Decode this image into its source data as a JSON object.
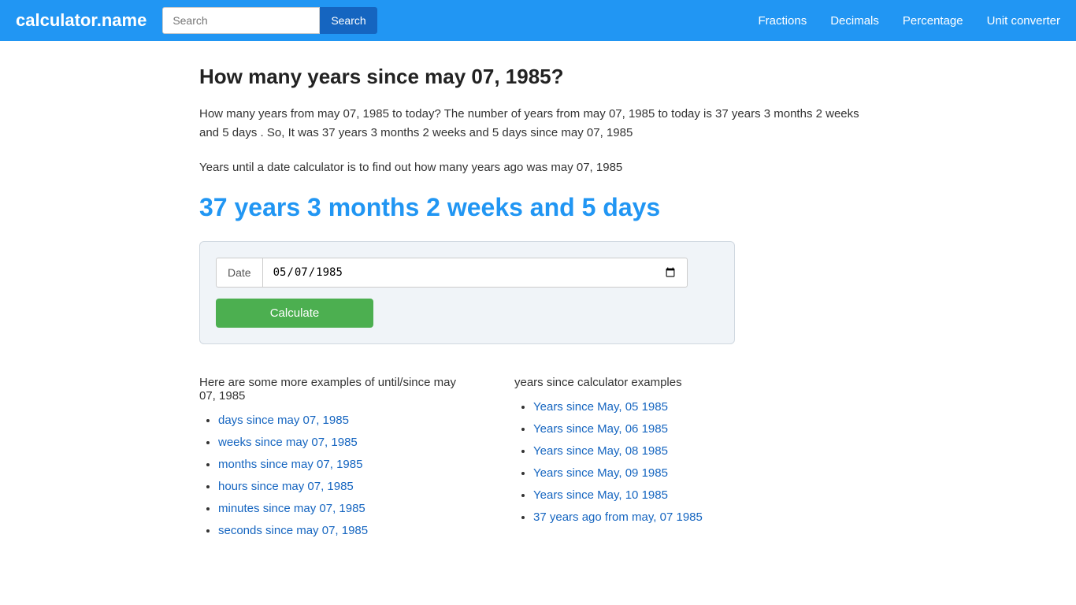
{
  "header": {
    "logo": "calculator.name",
    "search_placeholder": "Search",
    "search_button_label": "Search",
    "nav_items": [
      {
        "label": "Fractions",
        "href": "#"
      },
      {
        "label": "Decimals",
        "href": "#"
      },
      {
        "label": "Percentage",
        "href": "#"
      },
      {
        "label": "Unit converter",
        "href": "#"
      }
    ]
  },
  "page": {
    "title": "How many years since may 07, 1985?",
    "description1": "How many years from may 07, 1985 to today? The number of years from may 07, 1985 to today is 37 years 3 months 2 weeks and 5 days . So, It was 37 years 3 months 2 weeks and 5 days since may 07, 1985",
    "description2": "Years until a date calculator is to find out how many years ago was may 07, 1985",
    "result": "37 years 3 months 2 weeks and 5 days",
    "date_label": "Date",
    "date_value": "05/07/1985",
    "calculate_label": "Calculate",
    "examples_left_title": "Here are some more examples of until/since may 07, 1985",
    "examples_left": [
      {
        "label": "days since may 07, 1985",
        "href": "#"
      },
      {
        "label": "weeks since may 07, 1985",
        "href": "#"
      },
      {
        "label": "months since may 07, 1985",
        "href": "#"
      },
      {
        "label": "hours since may 07, 1985",
        "href": "#"
      },
      {
        "label": "minutes since may 07, 1985",
        "href": "#"
      },
      {
        "label": "seconds since may 07, 1985",
        "href": "#"
      }
    ],
    "examples_right_title": "years since calculator examples",
    "examples_right": [
      {
        "label": "Years since May, 05 1985",
        "href": "#"
      },
      {
        "label": "Years since May, 06 1985",
        "href": "#"
      },
      {
        "label": "Years since May, 08 1985",
        "href": "#"
      },
      {
        "label": "Years since May, 09 1985",
        "href": "#"
      },
      {
        "label": "Years since May, 10 1985",
        "href": "#"
      },
      {
        "label": "37 years ago from may, 07 1985",
        "href": "#"
      }
    ]
  }
}
